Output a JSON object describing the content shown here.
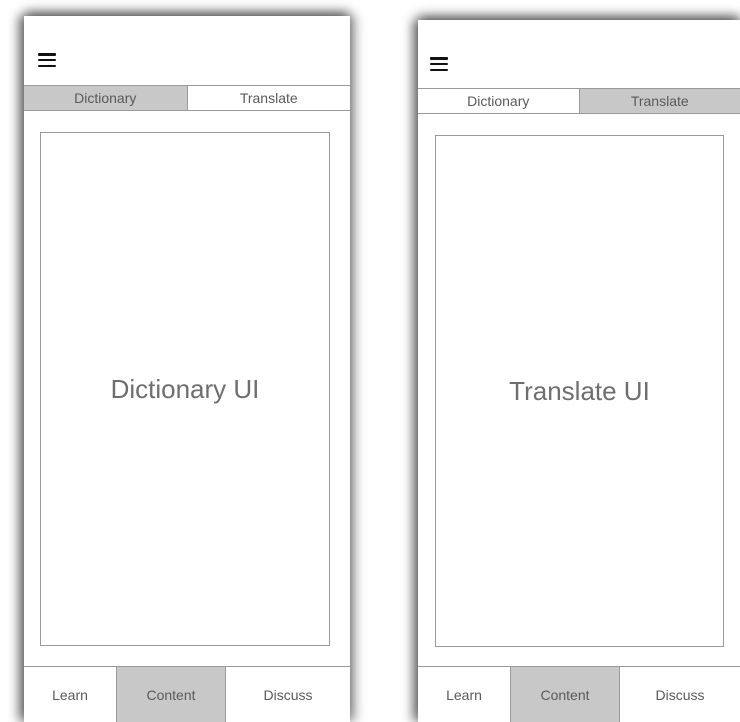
{
  "screens": [
    {
      "tabs": [
        {
          "label": "Dictionary",
          "active": true
        },
        {
          "label": "Translate",
          "active": false
        }
      ],
      "content_label": "Dictionary UI",
      "bottom_nav": [
        {
          "label": "Learn",
          "active": false
        },
        {
          "label": "Content",
          "active": true
        },
        {
          "label": "Discuss",
          "active": false
        }
      ]
    },
    {
      "tabs": [
        {
          "label": "Dictionary",
          "active": false
        },
        {
          "label": "Translate",
          "active": true
        }
      ],
      "content_label": "Translate UI",
      "bottom_nav": [
        {
          "label": "Learn",
          "active": false
        },
        {
          "label": "Content",
          "active": true
        },
        {
          "label": "Discuss",
          "active": false
        }
      ]
    }
  ],
  "colors": {
    "active_fill": "#c8c8c8",
    "border": "#9a9a9a",
    "text": "#5a5a5a",
    "content_text": "#6e6e6e"
  },
  "icons": {
    "menu": "hamburger-menu-icon"
  }
}
